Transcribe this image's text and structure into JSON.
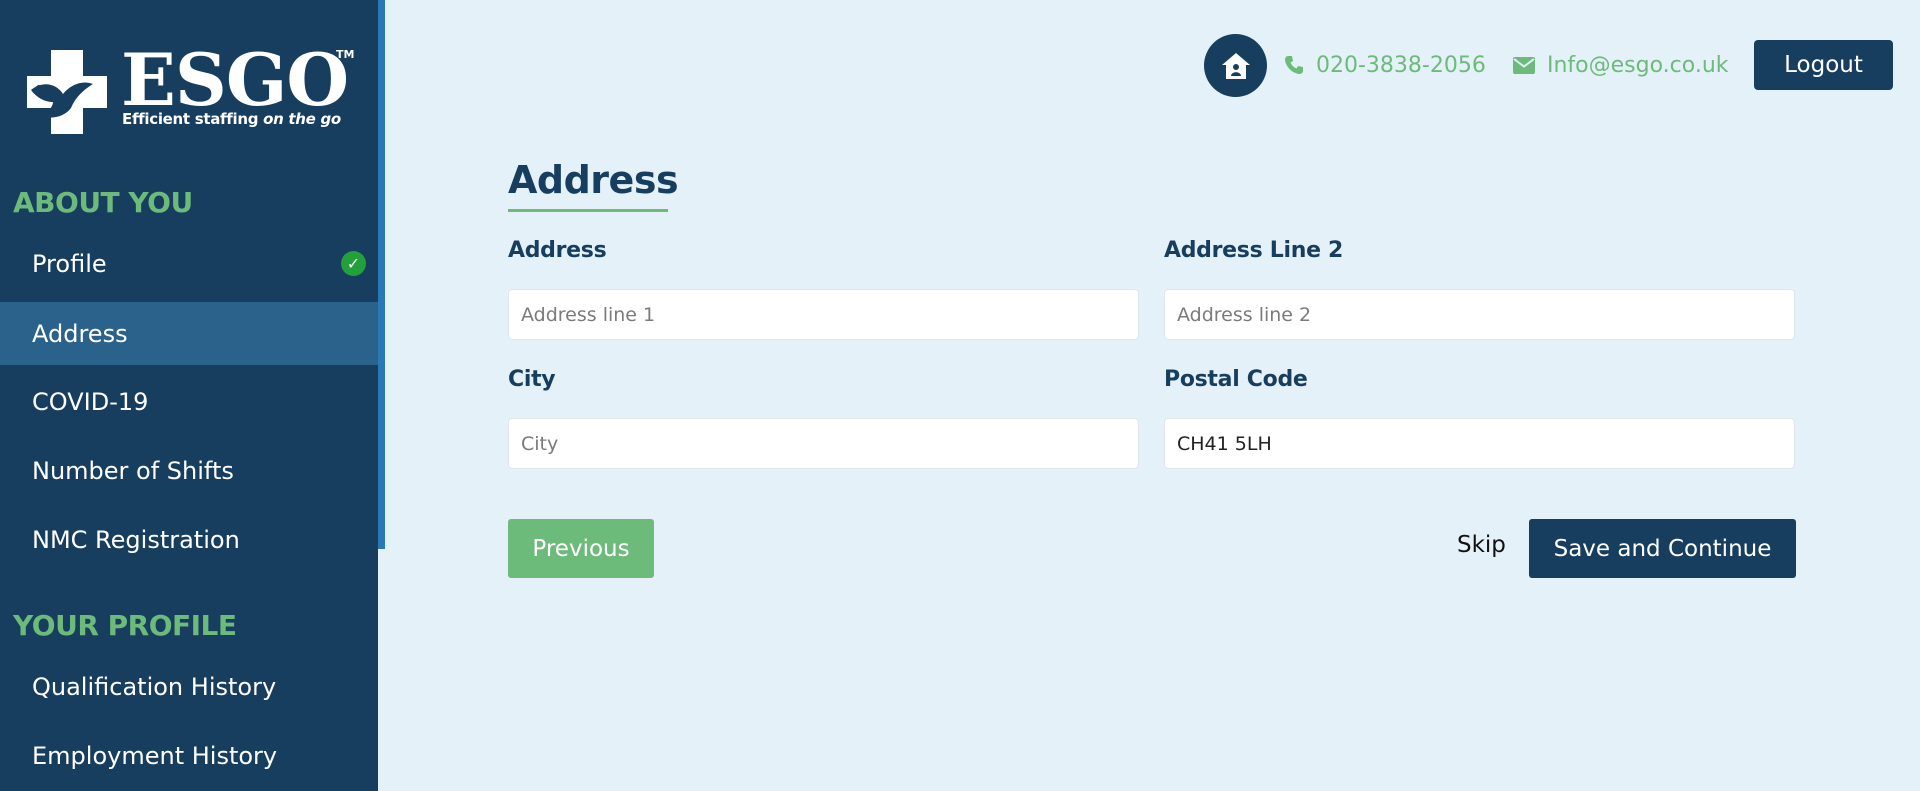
{
  "brand": {
    "name": "ESGO",
    "trademark": "TM",
    "tagline_prefix": "Efficient staffing",
    "tagline_suffix": "on the go"
  },
  "sidebar": {
    "sections": [
      {
        "heading": "ABOUT YOU",
        "items": [
          {
            "label": "Profile",
            "completed": true
          },
          {
            "label": "Address",
            "active": true
          },
          {
            "label": "COVID-19"
          },
          {
            "label": "Number of Shifts"
          },
          {
            "label": "NMC Registration"
          }
        ]
      },
      {
        "heading": "YOUR PROFILE",
        "items": [
          {
            "label": "Qualification History"
          },
          {
            "label": "Employment History"
          }
        ]
      }
    ]
  },
  "header": {
    "phone": "020-3838-2056",
    "email": "Info@esgo.co.uk",
    "logout_label": "Logout"
  },
  "form": {
    "title": "Address",
    "fields": {
      "address1": {
        "label": "Address",
        "placeholder": "Address line 1",
        "value": ""
      },
      "address2": {
        "label": "Address Line 2",
        "placeholder": "Address line 2",
        "value": ""
      },
      "city": {
        "label": "City",
        "placeholder": "City",
        "value": ""
      },
      "postal": {
        "label": "Postal Code",
        "placeholder": "",
        "value": "CH41 5LH"
      }
    },
    "previous_label": "Previous",
    "skip_label": "Skip",
    "save_label": "Save and Continue"
  },
  "colors": {
    "sidebar_bg": "#173e5f",
    "active_item_bg": "#2a628c",
    "accent_green": "#6dbb7a",
    "page_bg": "#e4f1f9",
    "check_green": "#22a03a"
  },
  "icons": {
    "home": "home-icon",
    "phone": "phone-icon",
    "email": "envelope-icon",
    "check": "check-icon"
  }
}
